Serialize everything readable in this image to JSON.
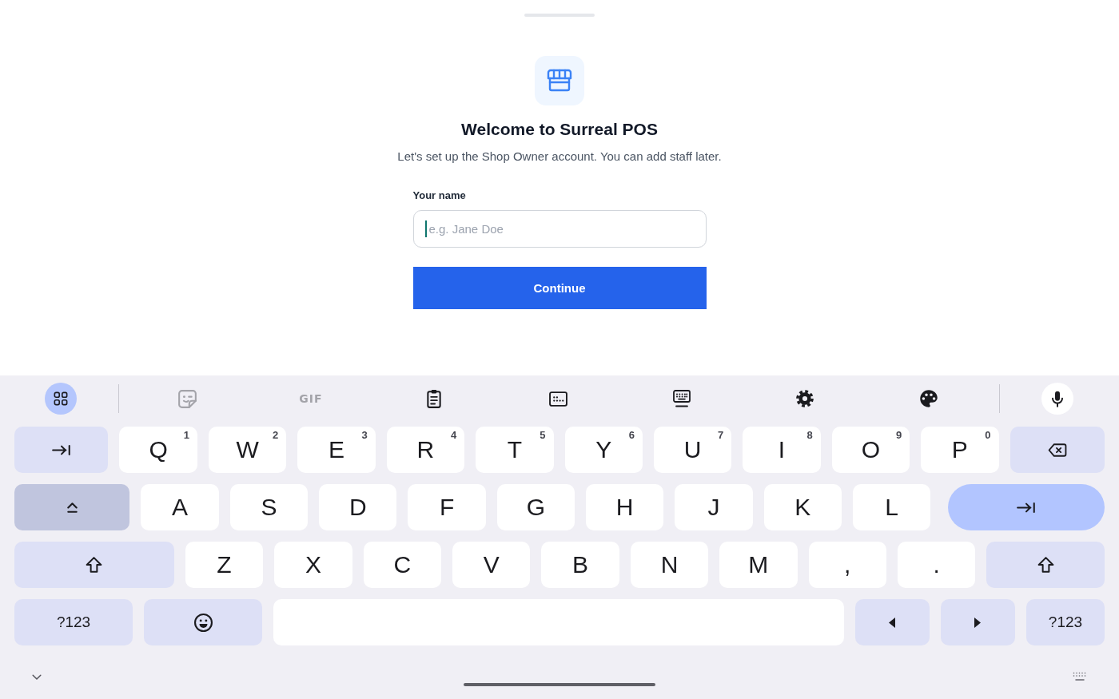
{
  "onboarding": {
    "title": "Welcome to Surreal POS",
    "subtitle": "Let's set up the Shop Owner account. You can add staff later.",
    "name_field": {
      "label": "Your name",
      "placeholder": "e.g. Jane Doe",
      "focused": true
    },
    "continue_button": {
      "label": "Continue"
    }
  },
  "keyboard": {
    "toolbar": {
      "menu_button": {
        "expanded": true
      },
      "tools": [
        {
          "disabled": true
        },
        {
          "label": "GIF",
          "disabled": true
        },
        {
          "disabled": false
        },
        {
          "disabled": false
        },
        {
          "disabled": false
        },
        {
          "disabled": false
        },
        {
          "disabled": false
        }
      ]
    },
    "rows": [
      [
        {
          "kind": "tab",
          "on": false
        },
        {
          "kind": "char",
          "label": "Q",
          "hint": "1",
          "on": false
        },
        {
          "kind": "char",
          "label": "W",
          "hint": "2",
          "on": false
        },
        {
          "kind": "char",
          "label": "E",
          "hint": "3",
          "on": false
        },
        {
          "kind": "char",
          "label": "R",
          "hint": "4",
          "on": false
        },
        {
          "kind": "char",
          "label": "T",
          "hint": "5",
          "on": false
        },
        {
          "kind": "char",
          "label": "Y",
          "hint": "6",
          "on": false
        },
        {
          "kind": "char",
          "label": "U",
          "hint": "7",
          "on": false
        },
        {
          "kind": "char",
          "label": "I",
          "hint": "8",
          "on": false
        },
        {
          "kind": "char",
          "label": "O",
          "hint": "9",
          "on": false
        },
        {
          "kind": "char",
          "label": "P",
          "hint": "0",
          "on": false
        },
        {
          "kind": "backspace",
          "on": false
        }
      ],
      [
        {
          "kind": "toggle",
          "on": true
        },
        {
          "kind": "char",
          "label": "A",
          "on": false
        },
        {
          "kind": "char",
          "label": "S",
          "on": false
        },
        {
          "kind": "char",
          "label": "D",
          "on": false
        },
        {
          "kind": "char",
          "label": "F",
          "on": false
        },
        {
          "kind": "char",
          "label": "G",
          "on": false
        },
        {
          "kind": "char",
          "label": "H",
          "on": false
        },
        {
          "kind": "char",
          "label": "J",
          "on": false
        },
        {
          "kind": "char",
          "label": "K",
          "on": false
        },
        {
          "kind": "char",
          "label": "L",
          "on": false
        },
        {
          "kind": "action",
          "on": false
        }
      ],
      [
        {
          "kind": "shift",
          "on": false
        },
        {
          "kind": "char",
          "label": "Z",
          "on": false
        },
        {
          "kind": "char",
          "label": "X",
          "on": false
        },
        {
          "kind": "char",
          "label": "C",
          "on": false
        },
        {
          "kind": "char",
          "label": "V",
          "on": false
        },
        {
          "kind": "char",
          "label": "B",
          "on": false
        },
        {
          "kind": "char",
          "label": "N",
          "on": false
        },
        {
          "kind": "char",
          "label": "M",
          "on": false
        },
        {
          "kind": "char",
          "label": ",",
          "on": false
        },
        {
          "kind": "char",
          "label": ".",
          "on": false
        },
        {
          "kind": "shift",
          "on": false
        }
      ],
      [
        {
          "kind": "symbols",
          "label": "?123",
          "on": false
        },
        {
          "kind": "emoji",
          "on": false
        },
        {
          "kind": "space",
          "on": false
        },
        {
          "kind": "left",
          "on": false
        },
        {
          "kind": "right",
          "on": false
        },
        {
          "kind": "symbols",
          "label": "?123",
          "on": false
        }
      ]
    ]
  }
}
